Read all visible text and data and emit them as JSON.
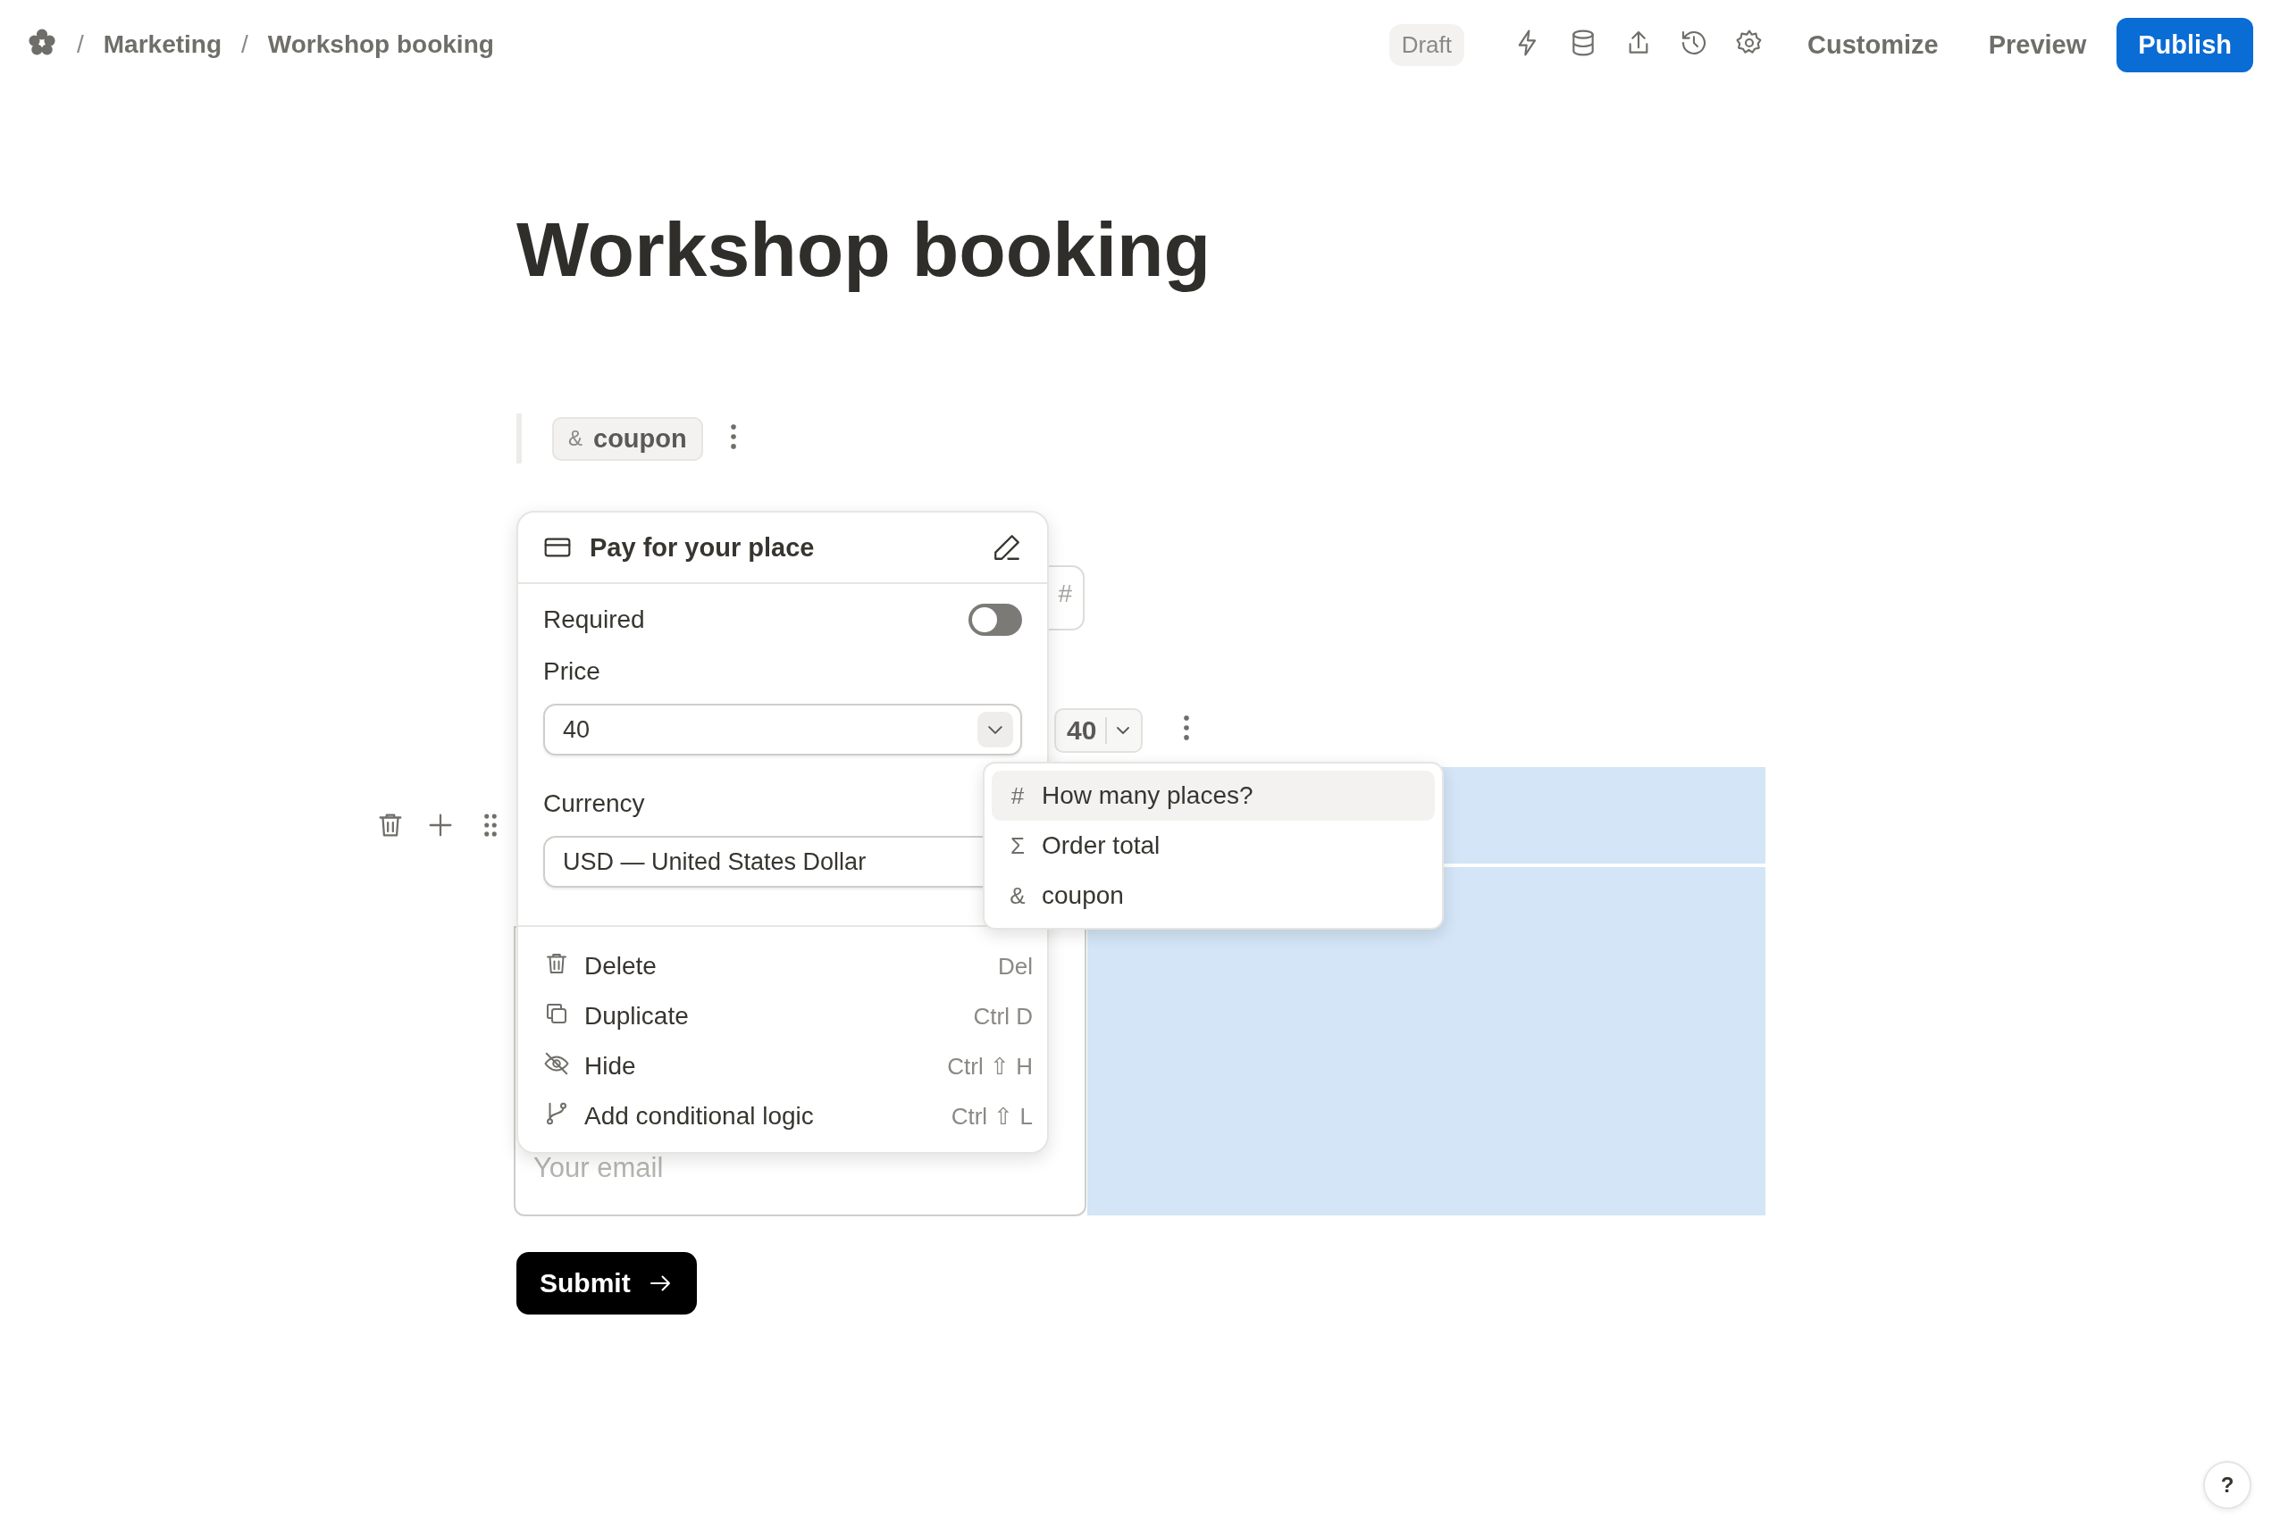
{
  "breadcrumb": [
    {
      "separator": "/",
      "label": "Marketing"
    },
    {
      "separator": "/",
      "label": "Workshop booking"
    }
  ],
  "status_badge": "Draft",
  "header_buttons": [
    {
      "label": "Customize",
      "kind": "plain"
    },
    {
      "label": "Preview",
      "kind": "plain"
    },
    {
      "label": "Publish",
      "kind": "primary"
    }
  ],
  "title": "Workshop booking",
  "variable_chip": {
    "symbol": "&",
    "label": "coupon"
  },
  "number_field": {
    "suffix": "#"
  },
  "price_chip": {
    "value": "40"
  },
  "email_field": {
    "placeholder": "Your email"
  },
  "submit_button": {
    "label": "Submit"
  },
  "block_settings": {
    "title": "Pay for your place",
    "required": {
      "label": "Required",
      "on": false
    },
    "price": {
      "label": "Price",
      "value": "40"
    },
    "currency": {
      "label": "Currency",
      "value": "USD — United States Dollar"
    },
    "actions": [
      {
        "kind": "delete",
        "label": "Delete",
        "shortcut": "Del"
      },
      {
        "kind": "duplicate",
        "label": "Duplicate",
        "shortcut": "Ctrl D"
      },
      {
        "kind": "hide",
        "label": "Hide",
        "shortcut": "Ctrl ⇧ H"
      },
      {
        "kind": "logic",
        "label": "Add conditional logic",
        "shortcut": "Ctrl ⇧ L"
      }
    ]
  },
  "variable_menu": [
    {
      "symbol": "#",
      "label": "How many places?",
      "selected": true
    },
    {
      "symbol": "Σ",
      "label": "Order total",
      "selected": false
    },
    {
      "symbol": "&",
      "label": "coupon",
      "selected": false
    }
  ],
  "help_button": "?"
}
